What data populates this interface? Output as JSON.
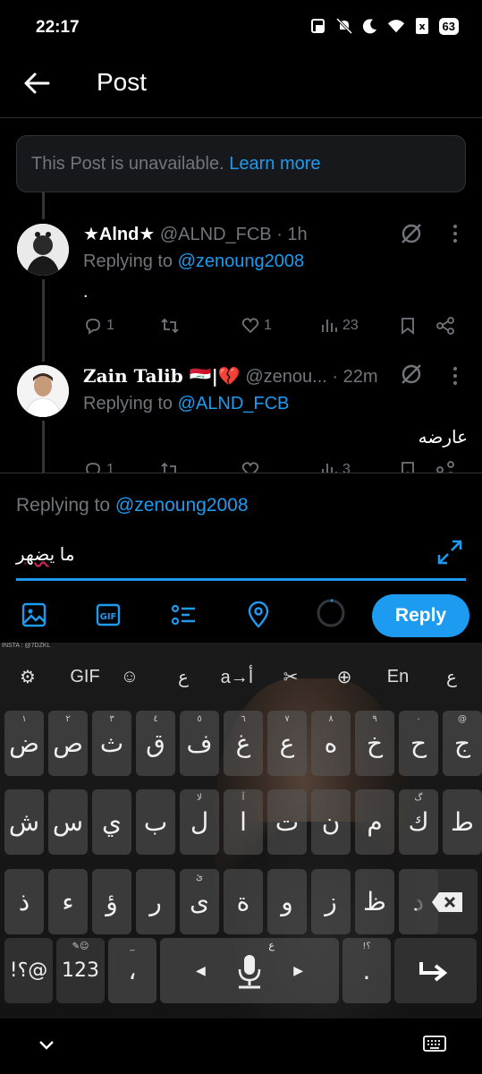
{
  "status": {
    "time": "22:17",
    "battery": "63"
  },
  "header": {
    "title": "Post"
  },
  "unavailable": {
    "text": "This Post is unavailable.",
    "link": "Learn more"
  },
  "tweets": [
    {
      "name": "★Alnd★",
      "handle": "@ALND_FCB",
      "time": "· 1h",
      "replying_label": "Replying to",
      "replying_to": "@zenoung2008",
      "body": ".",
      "replies": "1",
      "retweets": "",
      "likes": "1",
      "views": "23"
    },
    {
      "name": "Zain Talib 🇮🇶|💔",
      "handle": "@zenou...",
      "time": "· 22m",
      "replying_label": "Replying to",
      "replying_to": "@ALND_FCB",
      "body": "عارضه",
      "replies": "1",
      "retweets": "",
      "likes": "",
      "views": "3"
    }
  ],
  "composer": {
    "replying_label": "Replying to",
    "replying_to": "@zenoung2008",
    "text_prefix": "ما ",
    "text_misspelled": "يضهر",
    "reply_button": "Reply"
  },
  "keyboard": {
    "watermark": "INSTA : @7DZKL",
    "top_row": [
      "⚙",
      "GIF",
      "☺",
      "ع",
      "a→أ",
      "✂",
      "⊕",
      "En",
      "ع"
    ],
    "row1": [
      {
        "k": "ض",
        "h": "١"
      },
      {
        "k": "ص",
        "h": "٢"
      },
      {
        "k": "ث",
        "h": "٣"
      },
      {
        "k": "ق",
        "h": "٤"
      },
      {
        "k": "ف",
        "h": "٥"
      },
      {
        "k": "غ",
        "h": "٦"
      },
      {
        "k": "ع",
        "h": "٧"
      },
      {
        "k": "ه",
        "h": "٨"
      },
      {
        "k": "خ",
        "h": "٩"
      },
      {
        "k": "ح",
        "h": "٠"
      },
      {
        "k": "ج",
        "h": "@"
      }
    ],
    "row2": [
      {
        "k": "ش",
        "h": ""
      },
      {
        "k": "س",
        "h": ""
      },
      {
        "k": "ي",
        "h": ""
      },
      {
        "k": "ب",
        "h": ""
      },
      {
        "k": "ل",
        "h": "لا"
      },
      {
        "k": "ا",
        "h": "آ"
      },
      {
        "k": "ت",
        "h": ""
      },
      {
        "k": "ن",
        "h": ""
      },
      {
        "k": "م",
        "h": ""
      },
      {
        "k": "ك",
        "h": "گ"
      },
      {
        "k": "ط",
        "h": ""
      }
    ],
    "row3": [
      {
        "k": "ذ",
        "h": ""
      },
      {
        "k": "ء",
        "h": ""
      },
      {
        "k": "ؤ",
        "h": ""
      },
      {
        "k": "ر",
        "h": ""
      },
      {
        "k": "ى",
        "h": "ئ"
      },
      {
        "k": "ة",
        "h": ""
      },
      {
        "k": "و",
        "h": ""
      },
      {
        "k": "ز",
        "h": ""
      },
      {
        "k": "ظ",
        "h": ""
      },
      {
        "k": "د",
        "h": ""
      }
    ],
    "sym_key": "!؟@",
    "num_key": "123",
    "comma_key": "،",
    "mic_hint": "ع",
    "punct_hint": "!؟"
  }
}
